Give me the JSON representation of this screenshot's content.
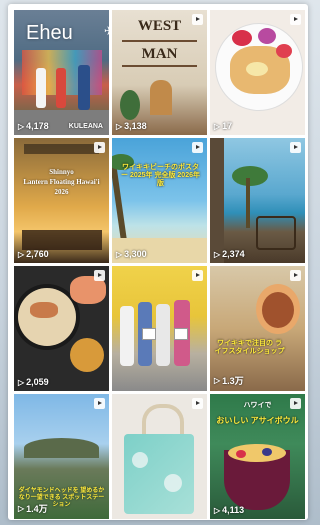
{
  "brand": "Eheu",
  "tiles": [
    {
      "views": "4,178",
      "tag": "KULEANA"
    },
    {
      "views": "3,138",
      "sign_line1": "WEST",
      "sign_line2": "MAN"
    },
    {
      "views": "17"
    },
    {
      "views": "2,760",
      "title_line1": "Shinnyo",
      "title_line2": "Lantern Floating Hawai'i",
      "title_line3": "2026"
    },
    {
      "views": "3,300",
      "caption": "ワイキキビーチのポスター 2025年 完全版 2026年版"
    },
    {
      "views": "2,374"
    },
    {
      "views": "2,059"
    },
    {
      "views": "",
      "caption": ""
    },
    {
      "views": "1.3万",
      "caption": "ワイキキで注目の ライフスタイルショップ"
    },
    {
      "views": "1.4万",
      "caption": "ダイヤモンドヘッドを 望めるかなり一望できる スポットステーション"
    },
    {
      "views": ""
    },
    {
      "views": "4,113",
      "tag": "ハワイで",
      "caption": "おいしい アサイボウル"
    }
  ]
}
